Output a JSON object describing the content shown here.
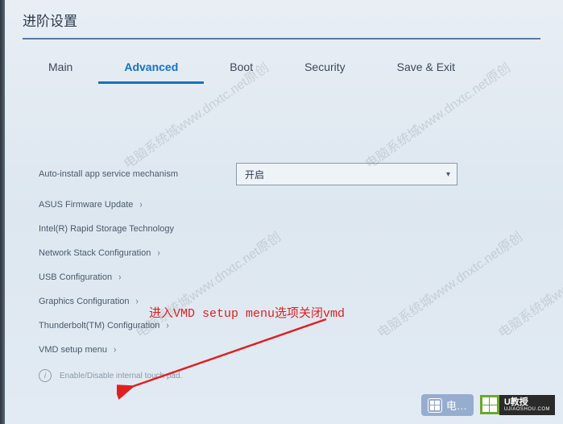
{
  "header": {
    "title": "进阶设置"
  },
  "tabs": [
    {
      "label": "Main",
      "active": false
    },
    {
      "label": "Advanced",
      "active": true
    },
    {
      "label": "Boot",
      "active": false
    },
    {
      "label": "Security",
      "active": false
    },
    {
      "label": "Save & Exit",
      "active": false
    }
  ],
  "settings": {
    "autoInstall": {
      "label": "Auto-install app service mechanism",
      "value": "开启"
    },
    "items": [
      {
        "label": "ASUS Firmware Update"
      },
      {
        "label": "Intel(R) Rapid Storage Technology"
      },
      {
        "label": "Network Stack Configuration"
      },
      {
        "label": "USB Configuration"
      },
      {
        "label": "Graphics Configuration"
      },
      {
        "label": "Thunderbolt(TM) Configuration"
      },
      {
        "label": "VMD setup menu"
      }
    ],
    "help": "Enable/Disable internal touch pad."
  },
  "annotation": {
    "text": "进入VMD setup menu选项关闭vmd"
  },
  "watermark": "电脑系统城www.dnxtc.net原创",
  "logos": {
    "dian": "电…",
    "ujiaoshou": {
      "main": "U教授",
      "sub": "UJIAOSHOU.COM"
    }
  }
}
